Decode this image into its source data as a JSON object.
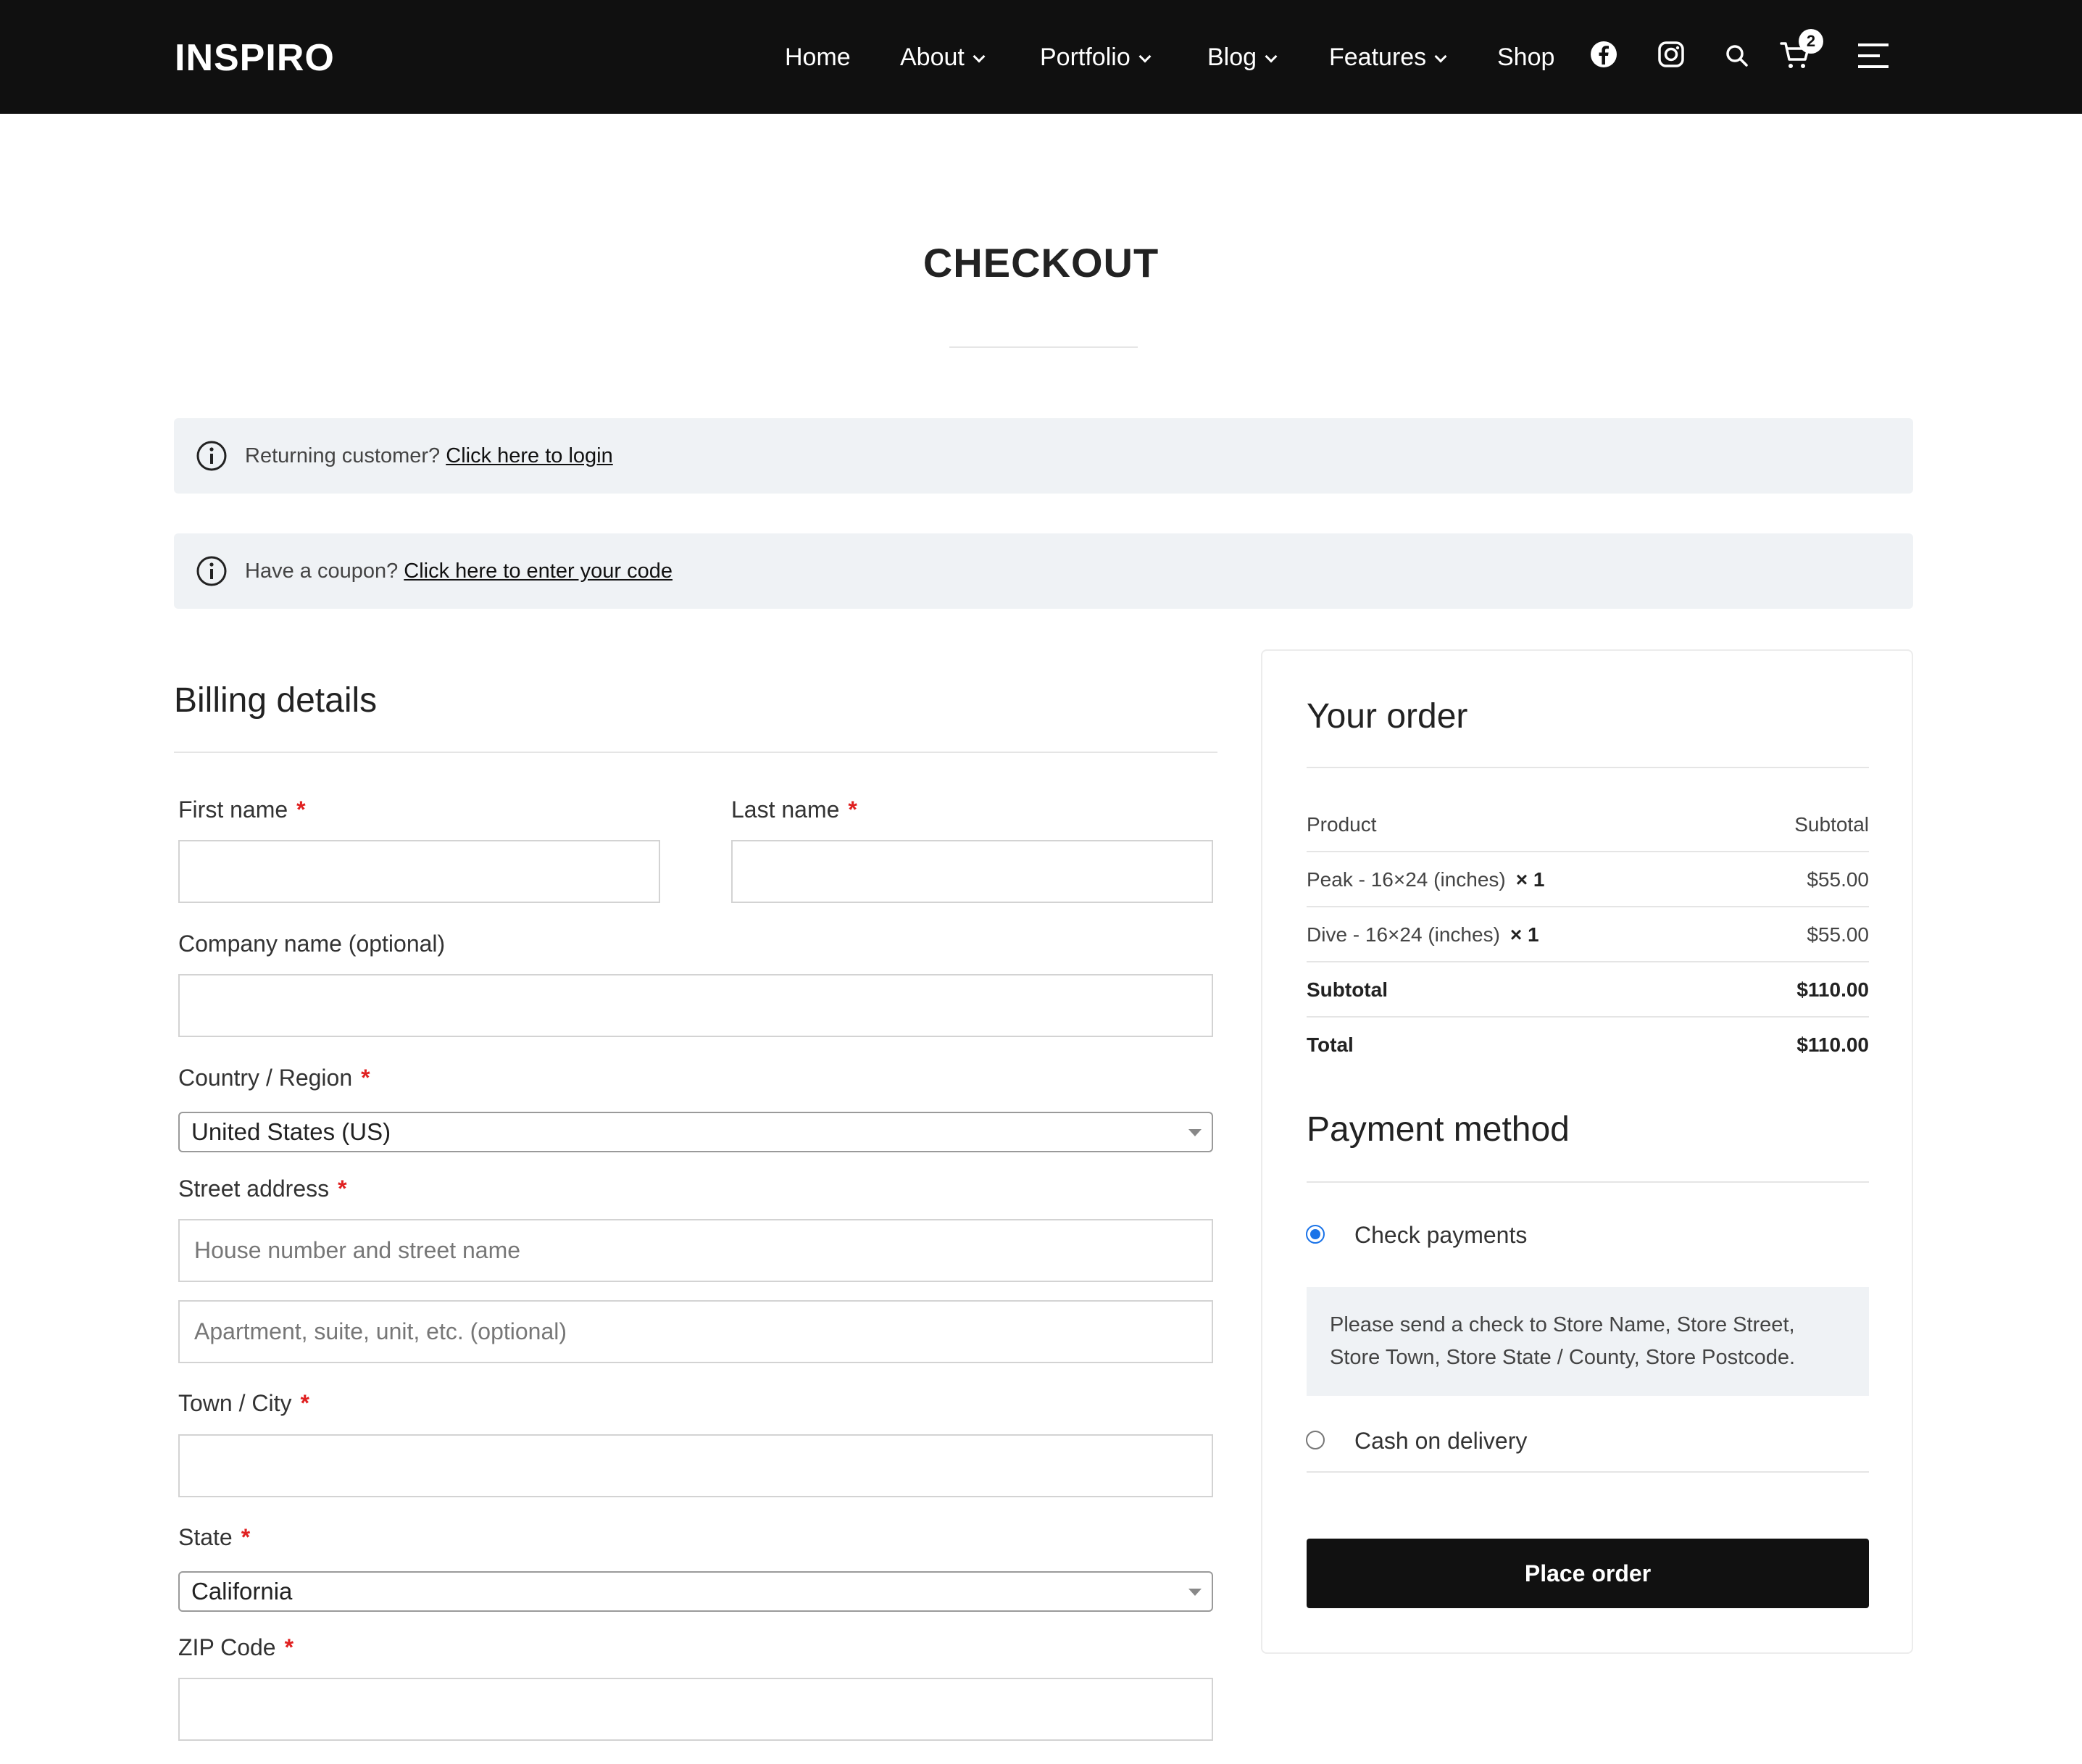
{
  "header": {
    "logo": "INSPIRO",
    "nav": [
      {
        "label": "Home"
      },
      {
        "label": "About"
      },
      {
        "label": "Portfolio"
      },
      {
        "label": "Blog"
      },
      {
        "label": "Features"
      },
      {
        "label": "Shop"
      }
    ],
    "cart_count": "2",
    "icons": [
      "facebook-icon",
      "instagram-icon",
      "search-icon",
      "cart-icon",
      "menu-icon"
    ]
  },
  "page": {
    "title": "CHECKOUT"
  },
  "notices": {
    "login": {
      "text": "Returning customer? ",
      "link": "Click here to login"
    },
    "coupon": {
      "text": "Have a coupon? ",
      "link": "Click here to enter your code"
    }
  },
  "billing": {
    "heading": "Billing details",
    "first_name": "First name",
    "last_name": "Last name",
    "company": "Company name (optional)",
    "country_label": "Country / Region",
    "country_value": "United States (US)",
    "street_label": "Street address",
    "street_placeholder": "House number and street name",
    "apt_placeholder": "Apartment, suite, unit, etc. (optional)",
    "city_label": "Town / City",
    "state_label": "State",
    "state_value": "California",
    "zip_label": "ZIP Code",
    "required_mark": "*"
  },
  "order": {
    "heading": "Your order",
    "col_product": "Product",
    "col_subtotal": "Subtotal",
    "items": [
      {
        "name": "Peak - 16×24 (inches)",
        "qty": "× 1",
        "price": "$55.00"
      },
      {
        "name": "Dive - 16×24 (inches)",
        "qty": "× 1",
        "price": "$55.00"
      }
    ],
    "subtotal_label": "Subtotal",
    "subtotal_value": "$110.00",
    "total_label": "Total",
    "total_value": "$110.00"
  },
  "payment": {
    "heading": "Payment method",
    "options": [
      {
        "label": "Check payments",
        "selected": true
      },
      {
        "label": "Cash on delivery",
        "selected": false
      }
    ],
    "check_description": "Please send a check to Store Name, Store Street, Store Town, Store State / County, Store Postcode.",
    "place_order": "Place order"
  },
  "colors": {
    "header_bg": "#101010",
    "notice_bg": "#eff2f5",
    "required": "#e02020",
    "radio_accent": "#1a73e8",
    "button_bg": "#111111"
  }
}
